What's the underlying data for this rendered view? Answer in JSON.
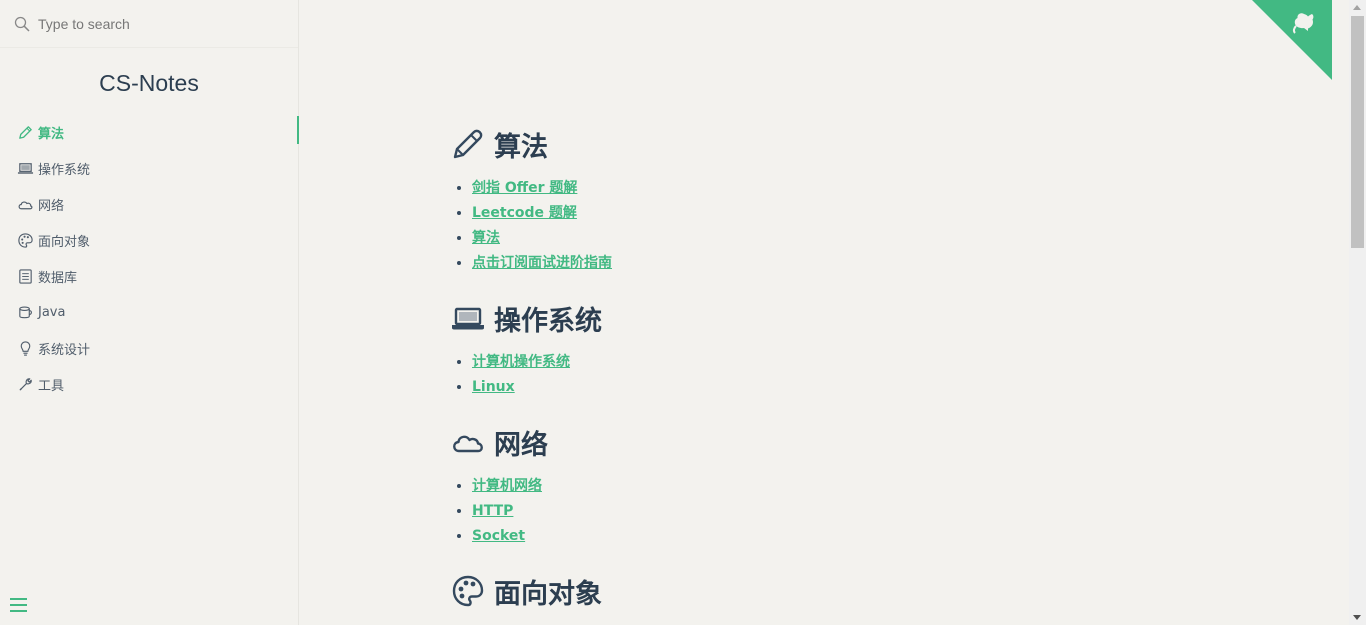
{
  "search": {
    "placeholder": "Type to search"
  },
  "app_name": "CS-Notes",
  "sidebar": {
    "items": [
      {
        "label": "算法",
        "icon": "pencil-icon",
        "active": true
      },
      {
        "label": "操作系统",
        "icon": "laptop-icon"
      },
      {
        "label": "网络",
        "icon": "cloud-icon"
      },
      {
        "label": "面向对象",
        "icon": "palette-icon"
      },
      {
        "label": "数据库",
        "icon": "database-icon"
      },
      {
        "label": "Java",
        "icon": "coffee-icon"
      },
      {
        "label": "系统设计",
        "icon": "lightbulb-icon"
      },
      {
        "label": "工具",
        "icon": "wrench-icon"
      }
    ]
  },
  "sections": [
    {
      "title": "算法",
      "icon": "pencil-icon",
      "links": [
        "剑指 Offer 题解",
        "Leetcode 题解",
        "算法",
        "点击订阅面试进阶指南"
      ]
    },
    {
      "title": "操作系统",
      "icon": "laptop-icon",
      "links": [
        "计算机操作系统",
        "Linux"
      ]
    },
    {
      "title": "网络",
      "icon": "cloud-icon",
      "links": [
        "计算机网络",
        "HTTP",
        "Socket"
      ]
    },
    {
      "title": "面向对象",
      "icon": "palette-icon",
      "links": []
    }
  ],
  "colors": {
    "accent": "#42b983",
    "text": "#2c3e50",
    "background": "#f3f2ee"
  }
}
